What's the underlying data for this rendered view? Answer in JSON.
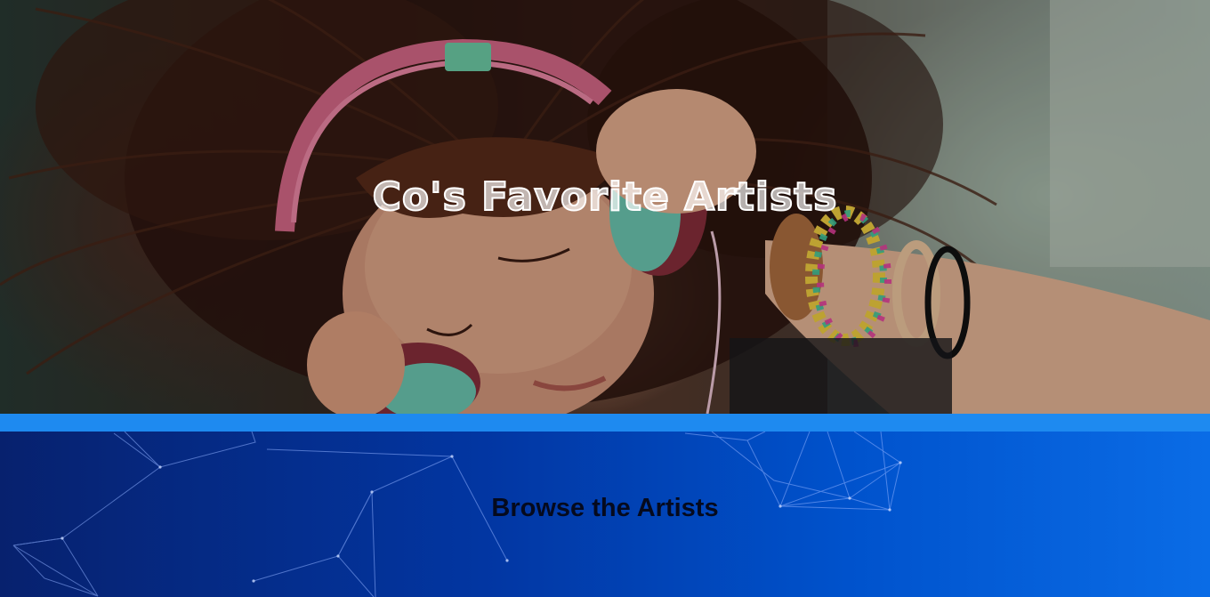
{
  "hero": {
    "title": "Co's Favorite Artists"
  },
  "browse": {
    "heading": "Browse the Artists"
  },
  "colors": {
    "divider": "#1e8af0",
    "browse_gradient_start": "#07216e",
    "browse_gradient_end": "#0a6ce6",
    "title_color": "#ffffff",
    "heading_color": "#050a1e"
  }
}
